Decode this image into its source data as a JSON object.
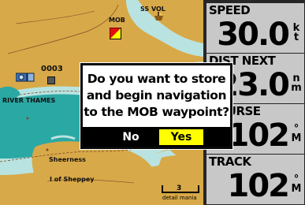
{
  "map": {
    "labels": {
      "mob": "MOB",
      "ss_vol": "SS VOL",
      "waypoint": "0003",
      "river": "RIVER THAMES",
      "sheerness": "Sheerness",
      "isle": "I of Sheppey"
    },
    "scale": {
      "value": "3",
      "detail": "detail mania"
    },
    "icons": [
      "mob-flag-icon",
      "ship-icon",
      "camera-icon",
      "waypoint-icon"
    ],
    "colors": {
      "land": "#d8a948",
      "water": "#2aa8a4",
      "shallow": "#b9e3e1",
      "depth_line": "#7a4b2a"
    }
  },
  "fields": [
    {
      "title": "SPEED",
      "value": "30.0",
      "unit": "k\nt"
    },
    {
      "title": "DIST NEXT",
      "value": "23.0",
      "unit": "n\nm"
    },
    {
      "title": "COURSE",
      "value": "102",
      "unit": "°\nM"
    },
    {
      "title": "TRACK",
      "value": "102",
      "unit": "°\nM"
    }
  ],
  "dialog": {
    "lines": [
      "Do you want to store",
      "and begin navigation",
      "to the MOB waypoint?"
    ],
    "no_label": "No",
    "yes_label": "Yes",
    "selected": "Yes"
  },
  "colors": {
    "field_bg": "#c8c8c8",
    "field_frame": "#262626",
    "selected_button": "#ffff00"
  }
}
